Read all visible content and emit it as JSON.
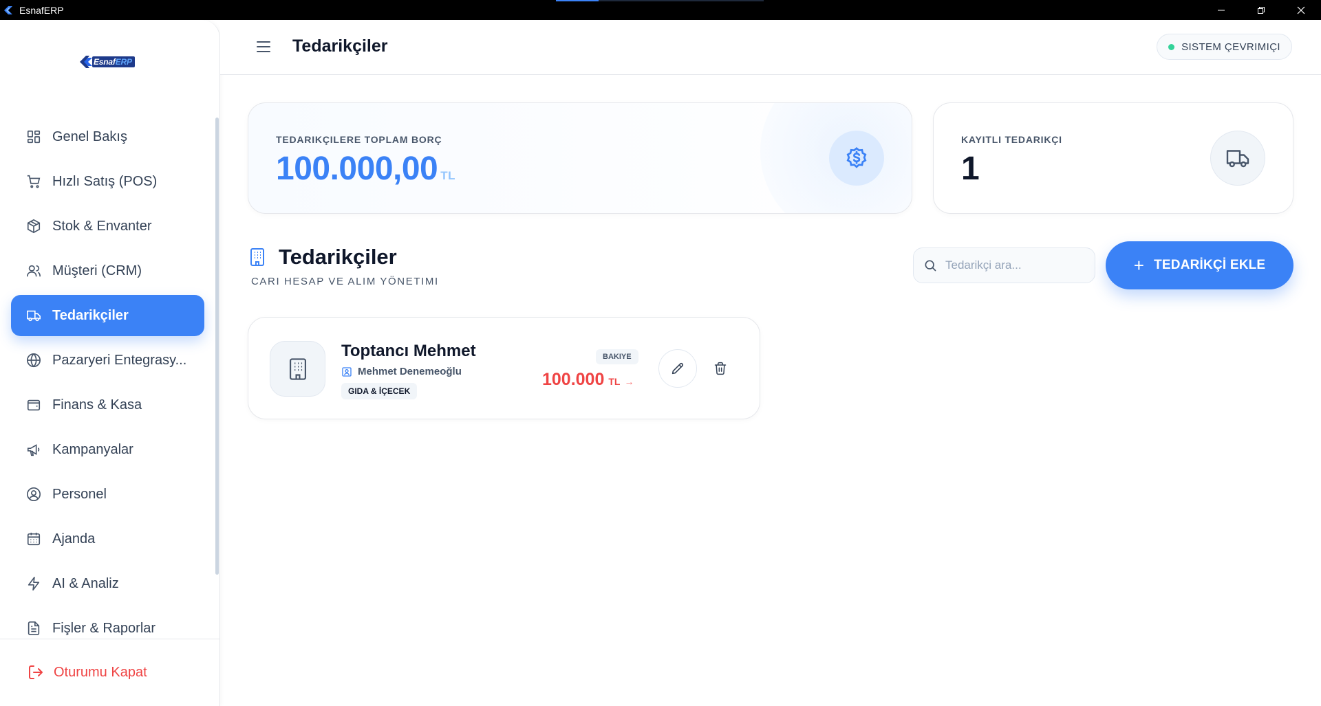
{
  "window": {
    "title": "EsnafERP"
  },
  "logo": {
    "brand": "Esnaf",
    "brand_suffix": "ERP"
  },
  "sidebar": {
    "items": [
      {
        "label": "Genel Bakış",
        "icon": "grid-icon"
      },
      {
        "label": "Hızlı Satış (POS)",
        "icon": "cart-icon"
      },
      {
        "label": "Stok & Envanter",
        "icon": "box-icon"
      },
      {
        "label": "Müşteri (CRM)",
        "icon": "users-icon"
      },
      {
        "label": "Tedarikçiler",
        "icon": "truck-icon",
        "active": true
      },
      {
        "label": "Pazaryeri Entegrasy...",
        "icon": "globe-icon"
      },
      {
        "label": "Finans & Kasa",
        "icon": "wallet-icon"
      },
      {
        "label": "Kampanyalar",
        "icon": "megaphone-icon"
      },
      {
        "label": "Personel",
        "icon": "user-circle-icon"
      },
      {
        "label": "Ajanda",
        "icon": "calendar-icon"
      },
      {
        "label": "AI & Analiz",
        "icon": "bolt-icon"
      },
      {
        "label": "Fişler & Raporlar",
        "icon": "document-icon"
      }
    ],
    "logout_label": "Oturumu Kapat"
  },
  "header": {
    "title": "Tedarikçiler",
    "status": "SISTEM ÇEVRIMIÇI",
    "status_color": "#34d399"
  },
  "stats": {
    "debt": {
      "label": "TEDARIKÇILERE TOPLAM BORÇ",
      "value": "100.000,00",
      "unit": "TL"
    },
    "count": {
      "label": "KAYITLI TEDARIKÇI",
      "value": "1"
    }
  },
  "section": {
    "title": "Tedarikçiler",
    "subtitle": "CARI HESAP VE ALIM YÖNETIMI",
    "search_placeholder": "Tedarikçi ara...",
    "add_button": "TEDARİKÇİ EKLE"
  },
  "suppliers": [
    {
      "name": "Toptancı Mehmet",
      "contact": "Mehmet Denemeoğlu",
      "category": "GIDA & İÇECEK",
      "balance_label": "BAKIYE",
      "balance": "100.000",
      "balance_unit": "TL",
      "balance_arrow": "→"
    }
  ],
  "colors": {
    "accent": "#3b82f6",
    "danger": "#ef4444",
    "text": "#0f172a"
  }
}
